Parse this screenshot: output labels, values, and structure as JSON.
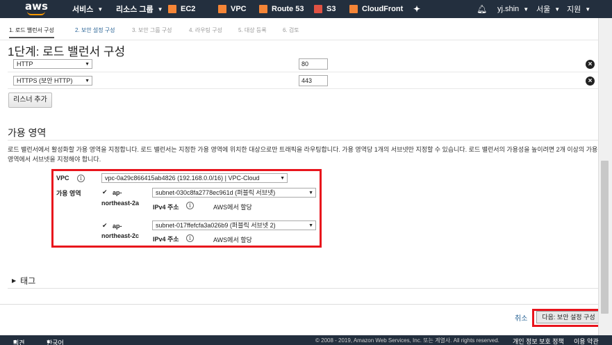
{
  "nav": {
    "logo": "aws",
    "services": "서비스",
    "resource_groups": "리소스 그룹",
    "shortcuts": [
      {
        "label": "EC2",
        "icon": "ec2-icon",
        "color": "#f58536"
      },
      {
        "label": "VPC",
        "icon": "vpc-icon",
        "color": "#f58536"
      },
      {
        "label": "Route 53",
        "icon": "route53-icon",
        "color": "#f58536"
      },
      {
        "label": "S3",
        "icon": "s3-icon",
        "color": "#e05243"
      },
      {
        "label": "CloudFront",
        "icon": "cloudfront-icon",
        "color": "#f58536"
      }
    ],
    "user": "yj.shin",
    "region": "서울",
    "support": "지원"
  },
  "steps": [
    "1. 로드 밸런서 구성",
    "2. 보안 설정 구성",
    "3. 보안 그룹 구성",
    "4. 라우팅 구성",
    "5. 대상 등록",
    "6. 검토"
  ],
  "page_title": "1단계: 로드 밸런서 구성",
  "listeners": [
    {
      "protocol": "HTTP",
      "port": "80"
    },
    {
      "protocol": "HTTPS (보안 HTTP)",
      "port": "443"
    }
  ],
  "add_listener": "리스너 추가",
  "az": {
    "title": "가용 영역",
    "description": "로드 밸런서에서 활성화할 가용 영역을 지정합니다. 로드 밸런서는 지정한 가용 영역에 위치한 대상으로만 트래픽을 라우팅합니다. 가용 영역당 1개의 서브넷만 지정할 수 있습니다. 로드 밸런서의 가용성을 높이려면 2개 이상의 가용 영역에서 서브넷을 지정해야 합니다.",
    "vpc_label": "VPC",
    "vpc_value": "vpc-0a29c866415ab4826 (192.168.0.0/16) | VPC-Cloud",
    "zones_label": "가용 영역",
    "zones": [
      {
        "name_line1": "ap-",
        "name_line2": "northeast-2a",
        "subnet": "subnet-030c8fa2778ec961d (퍼블릭 서브넷)",
        "ipv4_label": "IPv4 주소",
        "ipv4_value": "AWS에서 할당"
      },
      {
        "name_line1": "ap-",
        "name_line2": "northeast-2c",
        "subnet": "subnet-017ffefcfa3a026b9 (퍼블릭 서브넷 2)",
        "ipv4_label": "IPv4 주소",
        "ipv4_value": "AWS에서 할당"
      }
    ]
  },
  "tags_label": "태그",
  "actions": {
    "cancel": "취소",
    "next": "다음: 보안 설정 구성"
  },
  "footer": {
    "feedback": "의견",
    "language": "한국어",
    "copyright": "© 2008 - 2019, Amazon Web Services, Inc. 또는 계열사. All rights reserved.",
    "privacy": "개인 정보 보호 정책",
    "terms": "이용 약관"
  },
  "colors": {
    "nav_bg": "#232f3e",
    "highlight_box": "#e8141c",
    "link": "#2a6496"
  }
}
